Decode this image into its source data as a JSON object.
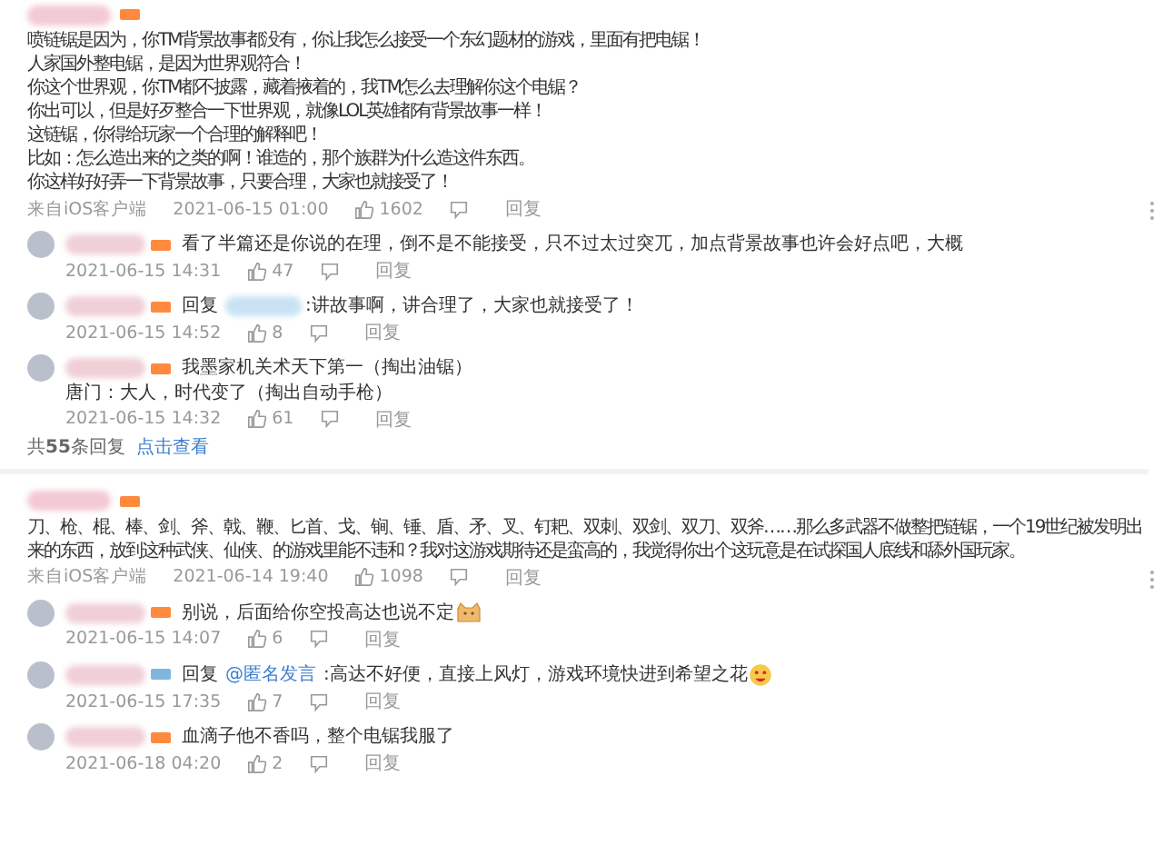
{
  "threads": [
    {
      "badge": {
        "color": "#ff8a3d"
      },
      "lines": [
        "喷链锯是因为，你TM背景故事都没有，你让我怎么接受一个东幻题材的游戏，里面有把电锯！",
        "人家国外整电锯，是因为世界观符合！",
        "你这个世界观，你TM都不披露，藏着掖着的，我TM怎么去理解你这个电锯？",
        "你出可以，但是好歹整合一下世界观，就像LOL英雄都有背景故事一样！",
        "这链锯，你得给玩家一个合理的解释吧！",
        "比如：怎么造出来的之类的啊！谁造的，那个族群为什么造这件东西。",
        "你这样好好弄一下背景故事，只要合理，大家也就接受了！"
      ],
      "source": "来自iOS客户端",
      "time": "2021-06-15 01:00",
      "likes": "1602",
      "reply_label": "回复",
      "replies": [
        {
          "badge": {
            "color": "#ff8a3d"
          },
          "lines": [
            "看了半篇还是你说的在理，倒不是不能接受，只不过太过突兀，加点背景故事也许会好点吧，大概"
          ],
          "time": "2021-06-15 14:31",
          "likes": "47",
          "reply_label": "回复"
        },
        {
          "badge": {
            "color": "#ff8a3d"
          },
          "target": {
            "kind": "blurred",
            "prefix": "回复"
          },
          "lines": [
            ":讲故事啊，讲合理了，大家也就接受了！"
          ],
          "time": "2021-06-15 14:52",
          "likes": "8",
          "reply_label": "回复"
        },
        {
          "badge": {
            "color": "#ff8a3d"
          },
          "lines": [
            "我墨家机关术天下第一（掏出油锯）",
            "唐门：大人，时代变了（掏出自动手枪）"
          ],
          "time": "2021-06-15 14:32",
          "likes": "61",
          "reply_label": "回复"
        }
      ],
      "footer": {
        "count": "共**55**条回复",
        "link": "点击查看"
      }
    },
    {
      "badge": {
        "color": "#ff8a3d"
      },
      "lines": [
        "刀、枪、棍、棒、剑、斧、戟、鞭、匕首、戈、锏、锤、盾、矛、叉、钉耙、双刺、双剑、双刀、双斧……那么多武器不做整把链锯，一个19世纪被发明出来的东西，放到这种武侠、仙侠、的游戏里能不违和？我对这游戏期待还是蛮高的，我觉得你出个这玩意是在试探国人底线和舔外国玩家。"
      ],
      "source": "来自iOS客户端",
      "time": "2021-06-14 19:40",
      "likes": "1098",
      "reply_label": "回复",
      "replies": [
        {
          "badge": {
            "color": "#ff8a3d"
          },
          "lines": [
            "别说，后面给你空投高达也说不定"
          ],
          "trailing_icon": {
            "kind": "cat"
          },
          "time": "2021-06-15 14:07",
          "likes": "6",
          "reply_label": "回复"
        },
        {
          "badge": {
            "color": "#7fb6e0"
          },
          "target": {
            "kind": "mention",
            "prefix": "回复",
            "text": "@匿名发言"
          },
          "lines": [
            ":高达不好便，直接上风灯，游戏环境快进到希望之花"
          ],
          "trailing_icon": {
            "kind": "smile"
          },
          "time": "2021-06-15 17:35",
          "likes": "7",
          "reply_label": "回复"
        },
        {
          "badge": {
            "color": "#ff8a3d"
          },
          "lines": [
            "血滴子他不香吗，整个电锯我服了"
          ],
          "time": "2021-06-18 04:20",
          "likes": "2",
          "reply_label": "回复"
        }
      ]
    }
  ]
}
